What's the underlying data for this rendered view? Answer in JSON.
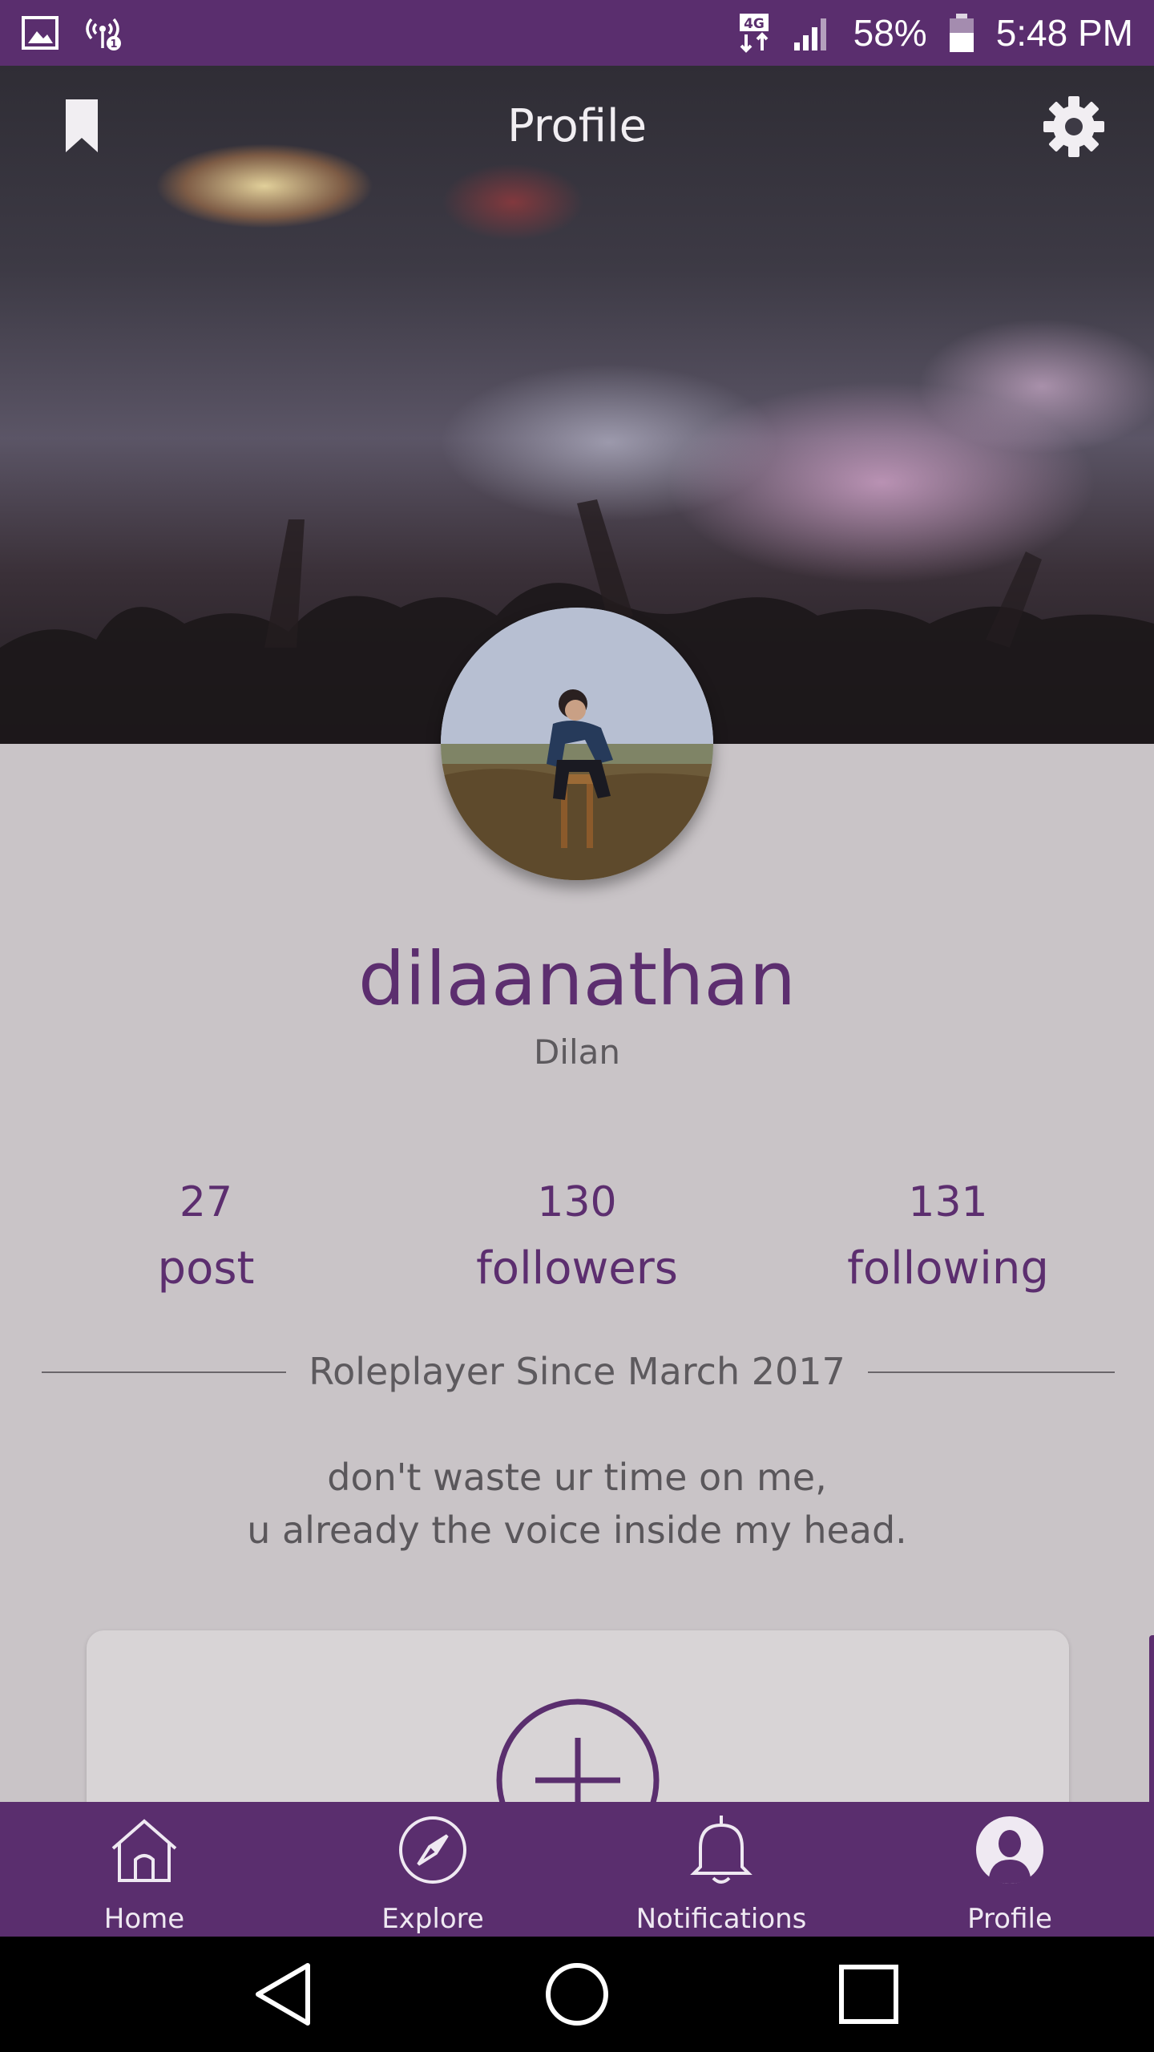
{
  "status_bar": {
    "network_badge": "4G",
    "battery": "58%",
    "time": "5:48 PM",
    "icons": [
      "gallery-icon",
      "hotspot-icon",
      "data-transfer-icon",
      "signal-icon",
      "battery-icon"
    ]
  },
  "header": {
    "title": "Profile",
    "left_icon": "bookmark-icon",
    "right_icon": "gear-icon"
  },
  "profile": {
    "username": "dilaanathan",
    "display_name": "Dilan",
    "stats": {
      "posts": {
        "count": "27",
        "label": "post"
      },
      "followers": {
        "count": "130",
        "label": "followers"
      },
      "following": {
        "count": "131",
        "label": "following"
      }
    },
    "since": "Roleplayer Since March 2017",
    "bio_line1": "don't waste ur time on me,",
    "bio_line2": "u already the voice inside my head."
  },
  "bottom_nav": {
    "items": [
      {
        "label": "Home",
        "icon": "home-icon"
      },
      {
        "label": "Explore",
        "icon": "compass-icon"
      },
      {
        "label": "Notifications",
        "icon": "bell-icon"
      },
      {
        "label": "Profile",
        "icon": "profile-avatar-icon"
      }
    ]
  },
  "colors": {
    "brand_purple": "#5a2e6e",
    "text_purple": "#5c2e6f",
    "background": "#c9c4c7"
  }
}
